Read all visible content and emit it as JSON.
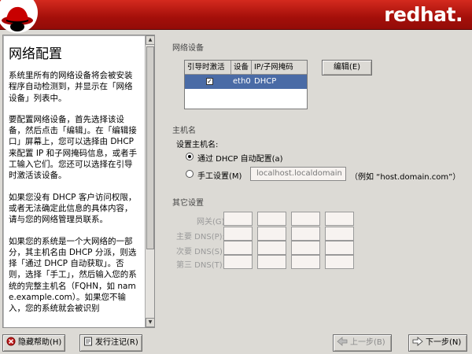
{
  "header": {
    "brand": "redhat."
  },
  "help": {
    "title": "网络配置",
    "paragraphs": [
      "系统里所有的网络设备将会被安装程序自动检测到，并显示在「网络设备」列表中。",
      "要配置网络设备，首先选择该设备，然后点击「编辑」。在「编辑接口」屏幕上，您可以选择由 DHCP 来配置 IP 和子网掩码信息，或者手工输入它们。您还可以选择在引导时激活该设备。",
      "如果您没有 DHCP 客户访问权限，或者无法确定此信息的具体内容，请与您的网络管理员联系。",
      "如果您的系统是一个大网络的一部分，其主机名由 DHCP 分派，则选择「通过 DHCP 自动获取」。否则，选择「手工」，然后输入您的系统的完整主机名（FQHN，如 name.example.com）。如果您不输入，您的系统就会被识别"
    ]
  },
  "network_devices": {
    "section_label": "网络设备",
    "columns": [
      "引导时激活",
      "设备",
      "IP/子网掩码"
    ],
    "rows": [
      {
        "active": true,
        "device": "eth0",
        "ip": "DHCP"
      }
    ],
    "edit_button": "编辑(E)"
  },
  "hostname": {
    "section_label": "主机名",
    "set_label": "设置主机名:",
    "dhcp_option": "通过 DHCP 自动配置(a)",
    "manual_option": "手工设置(M)",
    "manual_value": "localhost.localdomain",
    "example": "（例如 “host.domain.com”）",
    "selected": "dhcp"
  },
  "misc": {
    "section_label": "其它设置",
    "gateway": "网关(G):",
    "primary_dns": "主要 DNS(P):",
    "secondary_dns": "次要 DNS(S):",
    "tertiary_dns": "第三 DNS(T):"
  },
  "footer": {
    "hide_help": "隐藏帮助(H)",
    "release_notes": "发行注记(R)",
    "back": "上一步(B)",
    "next": "下一步(N)"
  },
  "colors": {
    "banner_red": "#c21a10",
    "selection": "#4a6ba6",
    "background": "#dcdad5"
  }
}
